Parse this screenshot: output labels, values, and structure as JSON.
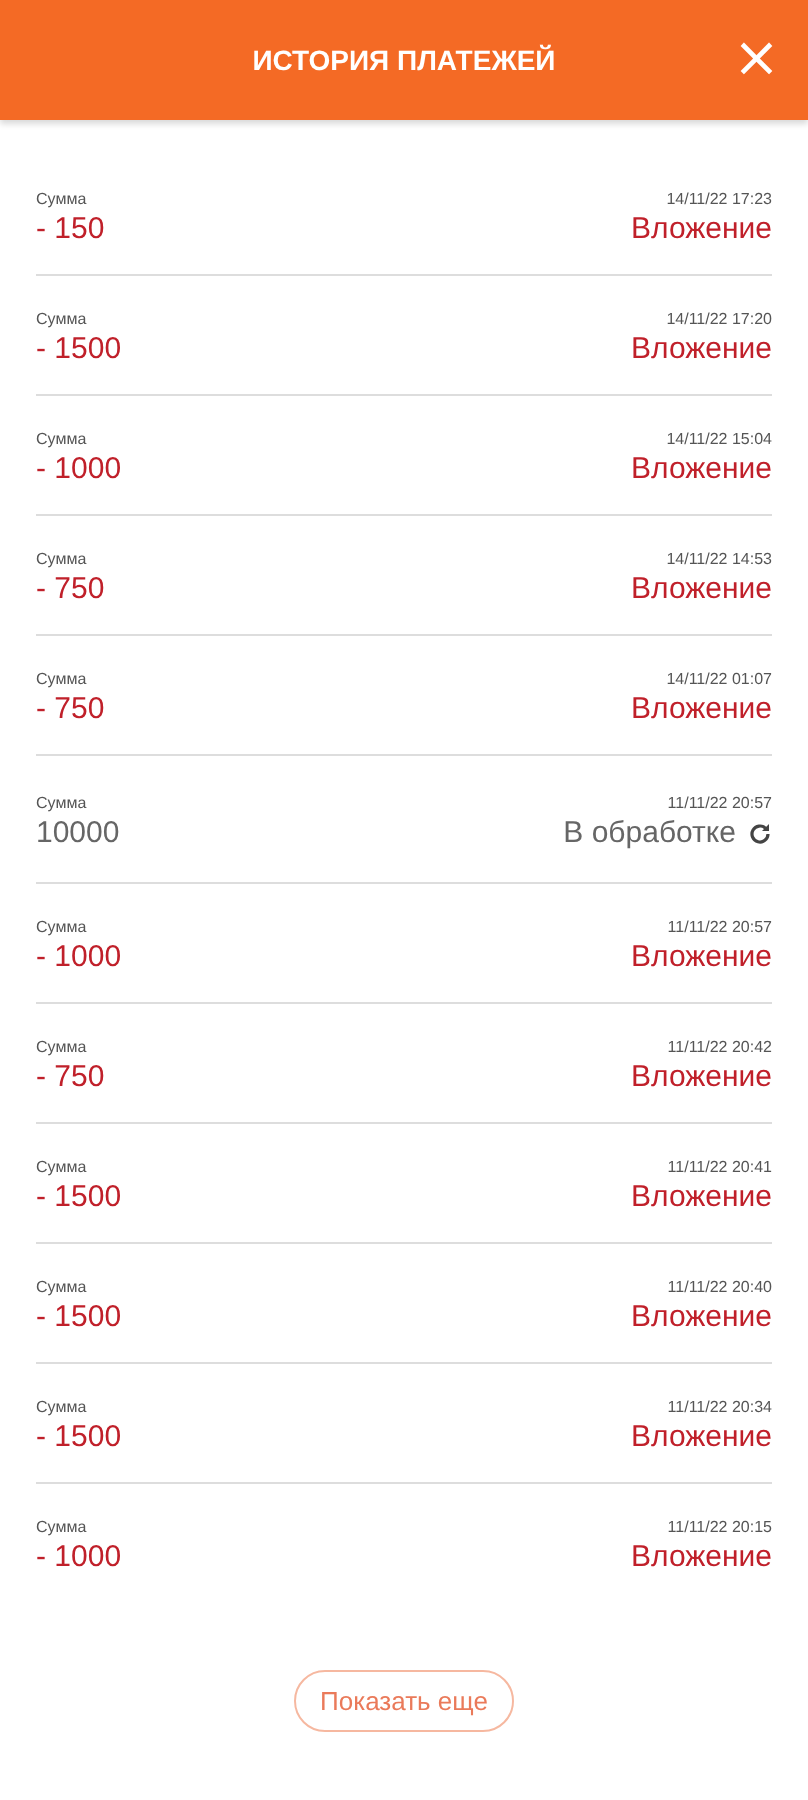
{
  "header": {
    "title": "ИСТОРИЯ ПЛАТЕЖЕЙ",
    "close": "×"
  },
  "payments": [
    {
      "kind": "investment",
      "label": "Сумма",
      "amount": "- 150",
      "date": "14/11/22 17:23",
      "status": "Вложение"
    },
    {
      "kind": "investment",
      "label": "Сумма",
      "amount": "- 1500",
      "date": "14/11/22 17:20",
      "status": "Вложение"
    },
    {
      "kind": "investment",
      "label": "Сумма",
      "amount": "- 1000",
      "date": "14/11/22 15:04",
      "status": "Вложение"
    },
    {
      "kind": "investment",
      "label": "Сумма",
      "amount": "- 750",
      "date": "14/11/22 14:53",
      "status": "Вложение"
    },
    {
      "kind": "investment",
      "label": "Сумма",
      "amount": "- 750",
      "date": "14/11/22 01:07",
      "status": "Вложение"
    },
    {
      "kind": "pending",
      "label": "Сумма",
      "amount": "10000",
      "date": "11/11/22 20:57",
      "status": "В обработке"
    },
    {
      "kind": "investment",
      "label": "Сумма",
      "amount": "- 1000",
      "date": "11/11/22 20:57",
      "status": "Вложение"
    },
    {
      "kind": "investment",
      "label": "Сумма",
      "amount": "- 750",
      "date": "11/11/22 20:42",
      "status": "Вложение"
    },
    {
      "kind": "investment",
      "label": "Сумма",
      "amount": "- 1500",
      "date": "11/11/22 20:41",
      "status": "Вложение"
    },
    {
      "kind": "investment",
      "label": "Сумма",
      "amount": "- 1500",
      "date": "11/11/22 20:40",
      "status": "Вложение"
    },
    {
      "kind": "investment",
      "label": "Сумма",
      "amount": "- 1500",
      "date": "11/11/22 20:34",
      "status": "Вложение"
    },
    {
      "kind": "investment",
      "label": "Сумма",
      "amount": "- 1000",
      "date": "11/11/22 20:15",
      "status": "Вложение"
    }
  ],
  "show_more": "Показать еще"
}
